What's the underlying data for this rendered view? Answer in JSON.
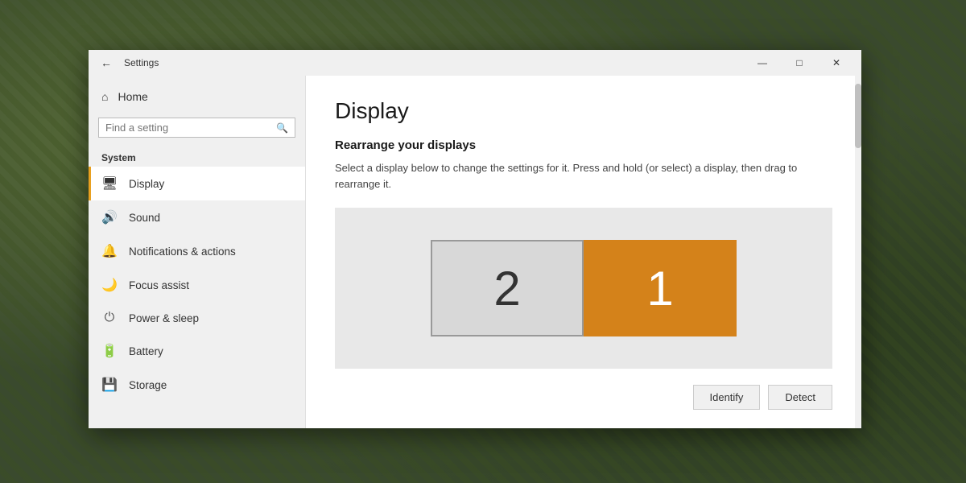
{
  "window": {
    "title": "Settings",
    "minimize_label": "—",
    "maximize_label": "□",
    "close_label": "✕"
  },
  "titlebar": {
    "back_icon": "←",
    "title": "Settings"
  },
  "sidebar": {
    "home_label": "Home",
    "home_icon": "⌂",
    "search_placeholder": "Find a setting",
    "search_icon": "🔍",
    "section_label": "System",
    "items": [
      {
        "id": "display",
        "label": "Display",
        "icon": "🖥",
        "active": true
      },
      {
        "id": "sound",
        "label": "Sound",
        "icon": "🔊",
        "active": false
      },
      {
        "id": "notifications",
        "label": "Notifications & actions",
        "icon": "🔔",
        "active": false
      },
      {
        "id": "focus-assist",
        "label": "Focus assist",
        "icon": "🌙",
        "active": false
      },
      {
        "id": "power",
        "label": "Power & sleep",
        "icon": "⏻",
        "active": false
      },
      {
        "id": "battery",
        "label": "Battery",
        "icon": "🔋",
        "active": false
      },
      {
        "id": "storage",
        "label": "Storage",
        "icon": "💾",
        "active": false
      }
    ]
  },
  "main": {
    "page_title": "Display",
    "section_heading": "Rearrange your displays",
    "section_desc": "Select a display below to change the settings for it. Press and hold (or select) a display, then drag to rearrange it.",
    "display2_label": "2",
    "display1_label": "1",
    "identify_btn": "Identify",
    "detect_btn": "Detect",
    "colors": {
      "display1_bg": "#d4821a",
      "display2_bg": "#d8d8d8"
    }
  }
}
